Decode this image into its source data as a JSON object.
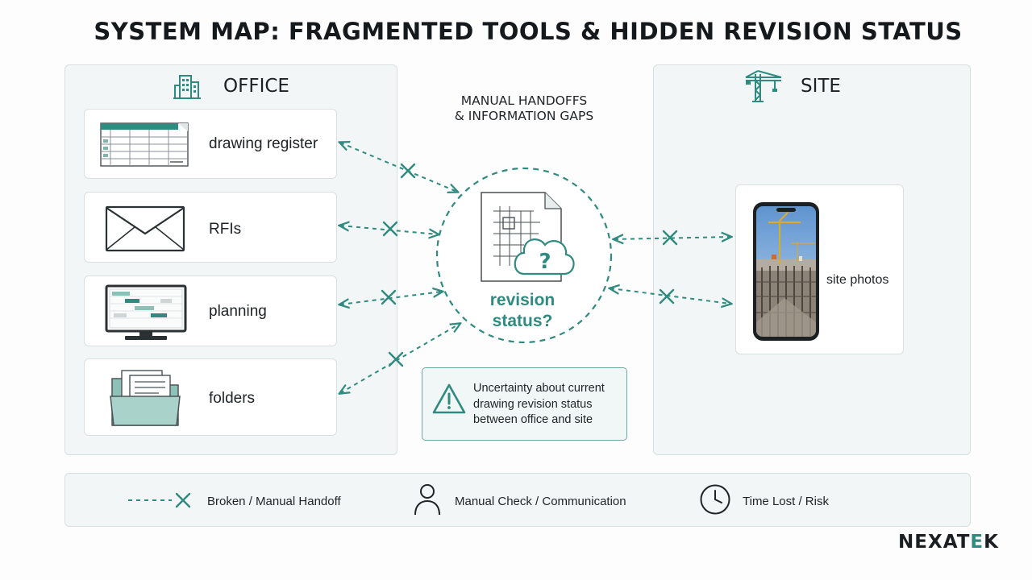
{
  "title": "SYSTEM MAP: FRAGMENTED TOOLS & HIDDEN REVISION STATUS",
  "office": {
    "title": "OFFICE",
    "icon": "office-building-icon",
    "items": [
      {
        "label": "drawing register",
        "icon": "spreadsheet-icon"
      },
      {
        "label": "RFIs",
        "icon": "envelope-icon"
      },
      {
        "label": "planning",
        "icon": "monitor-gantt-icon"
      },
      {
        "label": "folders",
        "icon": "folder-icon"
      }
    ]
  },
  "site": {
    "title": "SITE",
    "icon": "tower-crane-icon",
    "item": {
      "label": "site photos",
      "icon": "smartphone-photo-icon"
    }
  },
  "center": {
    "gaps_line1": "MANUAL HANDOFFS",
    "gaps_line2": "& INFORMATION GAPS",
    "revision_line1": "revision",
    "revision_line2": "status?",
    "icon": "drawing-cloud-question-icon"
  },
  "warning": {
    "text": "Uncertainty about current drawing revision status between office and site",
    "icon": "warning-triangle-icon"
  },
  "legend": {
    "items": [
      {
        "label": "Broken / Manual Handoff",
        "icon": "broken-link-x-icon"
      },
      {
        "label": "Manual Check / Communication",
        "icon": "person-icon"
      },
      {
        "label": "Time Lost / Risk",
        "icon": "clock-icon"
      }
    ]
  },
  "colors": {
    "accent": "#2f8a7f",
    "panel_bg": "#f3f6f6",
    "border": "#d7dfdf"
  },
  "logo": {
    "part1": "NEXAT",
    "part2": "E",
    "part3": "K"
  }
}
